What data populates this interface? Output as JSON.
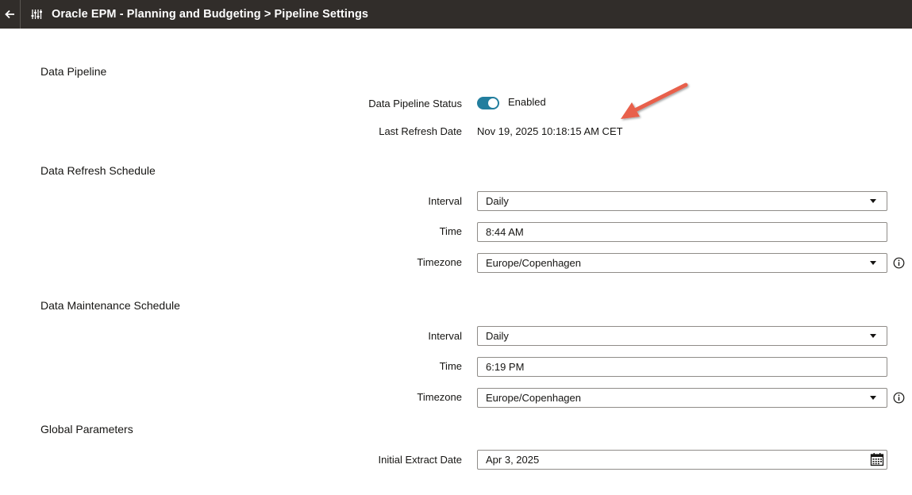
{
  "header": {
    "title": "Oracle EPM - Planning and Budgeting > Pipeline Settings",
    "back_icon": "back-arrow-icon",
    "settings_icon": "sliders-icon"
  },
  "pipeline": {
    "section_title": "Data Pipeline",
    "status_label": "Data Pipeline Status",
    "status_value": "Enabled",
    "status_enabled": true,
    "refresh_label": "Last Refresh Date",
    "refresh_value": "Nov 19, 2025 10:18:15 AM CET"
  },
  "refresh_schedule": {
    "section_title": "Data Refresh Schedule",
    "interval_label": "Interval",
    "interval_value": "Daily",
    "time_label": "Time",
    "time_value": "8:44 AM",
    "timezone_label": "Timezone",
    "timezone_value": "Europe/Copenhagen"
  },
  "maintenance_schedule": {
    "section_title": "Data Maintenance Schedule",
    "interval_label": "Interval",
    "interval_value": "Daily",
    "time_label": "Time",
    "time_value": "6:19 PM",
    "timezone_label": "Timezone",
    "timezone_value": "Europe/Copenhagen"
  },
  "global_parameters": {
    "section_title": "Global Parameters",
    "extract_label": "Initial Extract Date",
    "extract_value": "Apr 3, 2025"
  },
  "colors": {
    "header_bg": "#312d2a",
    "toggle_on": "#227e9e",
    "annotation_arrow": "#e8604c"
  }
}
